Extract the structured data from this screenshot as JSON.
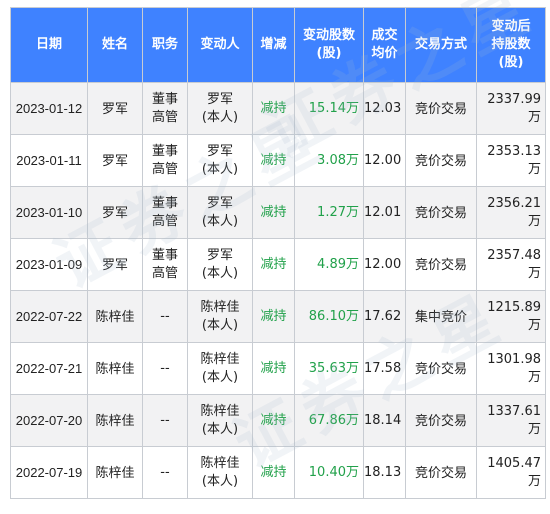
{
  "table": {
    "headers": [
      {
        "lines": [
          "日期"
        ]
      },
      {
        "lines": [
          "姓名"
        ]
      },
      {
        "lines": [
          "职务"
        ]
      },
      {
        "lines": [
          "变动人"
        ]
      },
      {
        "lines": [
          "增减"
        ]
      },
      {
        "lines": [
          "变动股数",
          "(股)"
        ]
      },
      {
        "lines": [
          "成交",
          "均价"
        ]
      },
      {
        "lines": [
          "交易方式"
        ]
      },
      {
        "lines": [
          "变动后",
          "持股数",
          "(股)"
        ]
      }
    ],
    "rows": [
      {
        "date": "2023-01-12",
        "name": "罗军",
        "title": [
          "董事",
          "高管"
        ],
        "person": [
          "罗军",
          "(本人)"
        ],
        "change": "减持",
        "shares": "15.14万",
        "price": "12.03",
        "method": "竞价交易",
        "after": "2337.99万"
      },
      {
        "date": "2023-01-11",
        "name": "罗军",
        "title": [
          "董事",
          "高管"
        ],
        "person": [
          "罗军",
          "(本人)"
        ],
        "change": "减持",
        "shares": "3.08万",
        "price": "12.00",
        "method": "竞价交易",
        "after": "2353.13万"
      },
      {
        "date": "2023-01-10",
        "name": "罗军",
        "title": [
          "董事",
          "高管"
        ],
        "person": [
          "罗军",
          "(本人)"
        ],
        "change": "减持",
        "shares": "1.27万",
        "price": "12.01",
        "method": "竞价交易",
        "after": "2356.21万"
      },
      {
        "date": "2023-01-09",
        "name": "罗军",
        "title": [
          "董事",
          "高管"
        ],
        "person": [
          "罗军",
          "(本人)"
        ],
        "change": "减持",
        "shares": "4.89万",
        "price": "12.00",
        "method": "竞价交易",
        "after": "2357.48万"
      },
      {
        "date": "2022-07-22",
        "name": "陈梓佳",
        "title": [
          "--"
        ],
        "person": [
          "陈梓佳",
          "(本人)"
        ],
        "change": "减持",
        "shares": "86.10万",
        "price": "17.62",
        "method": "集中竞价",
        "after": "1215.89万"
      },
      {
        "date": "2022-07-21",
        "name": "陈梓佳",
        "title": [
          "--"
        ],
        "person": [
          "陈梓佳",
          "(本人)"
        ],
        "change": "减持",
        "shares": "35.63万",
        "price": "17.58",
        "method": "竞价交易",
        "after": "1301.98万"
      },
      {
        "date": "2022-07-20",
        "name": "陈梓佳",
        "title": [
          "--"
        ],
        "person": [
          "陈梓佳",
          "(本人)"
        ],
        "change": "减持",
        "shares": "67.86万",
        "price": "18.14",
        "method": "竞价交易",
        "after": "1337.61万"
      },
      {
        "date": "2022-07-19",
        "name": "陈梓佳",
        "title": [
          "--"
        ],
        "person": [
          "陈梓佳",
          "(本人)"
        ],
        "change": "减持",
        "shares": "10.40万",
        "price": "18.13",
        "method": "竞价交易",
        "after": "1405.47万"
      }
    ]
  },
  "watermark": {
    "text": "证券之星"
  },
  "colors": {
    "header_bg": "#3f82ff",
    "header_text": "#ffffff",
    "decrease_text": "#21a14a",
    "row_alt": "#f2f2f3",
    "border": "#c8ccd2"
  }
}
